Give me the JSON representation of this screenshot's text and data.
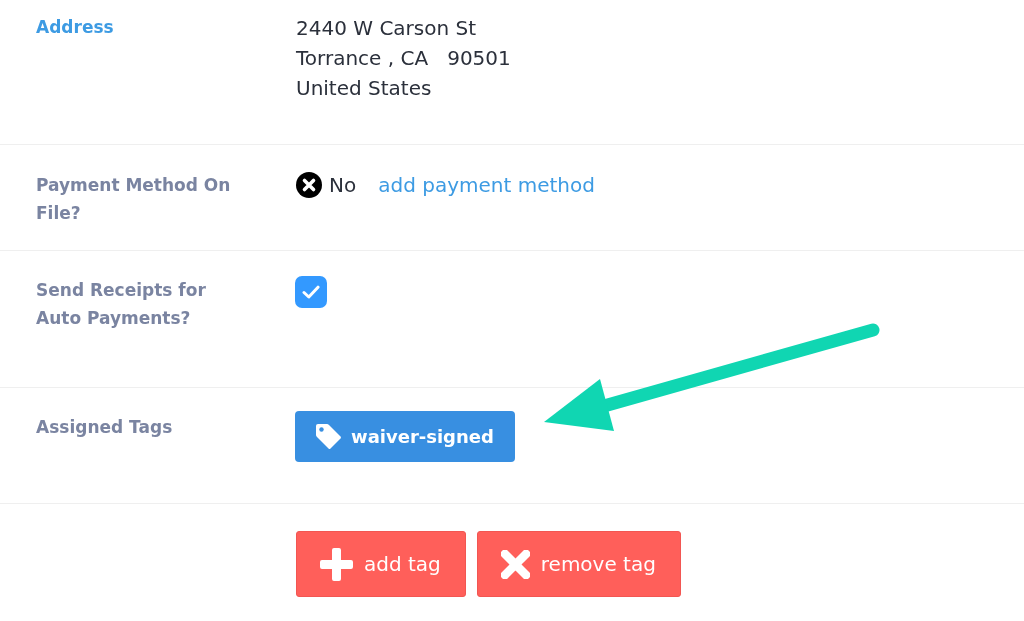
{
  "fields": [
    {
      "kind": "address",
      "label": "Address",
      "highlighted": true,
      "lines": [
        "2440 W Carson St",
        "Torrance , CA   90501",
        "United States"
      ]
    },
    {
      "kind": "payment",
      "label": "Payment Method On File?",
      "highlighted": false,
      "on_file": false,
      "value": "No",
      "link": "add payment method"
    },
    {
      "kind": "checkbox",
      "label": "Send Receipts for Auto Payments?",
      "highlighted": false,
      "checked": true
    },
    {
      "kind": "tags",
      "label": "Assigned Tags",
      "highlighted": false,
      "tags": [
        "waiver-signed"
      ]
    }
  ],
  "actions": [
    {
      "kind": "add",
      "label": "add tag"
    },
    {
      "kind": "remove",
      "label": "remove tag"
    }
  ]
}
